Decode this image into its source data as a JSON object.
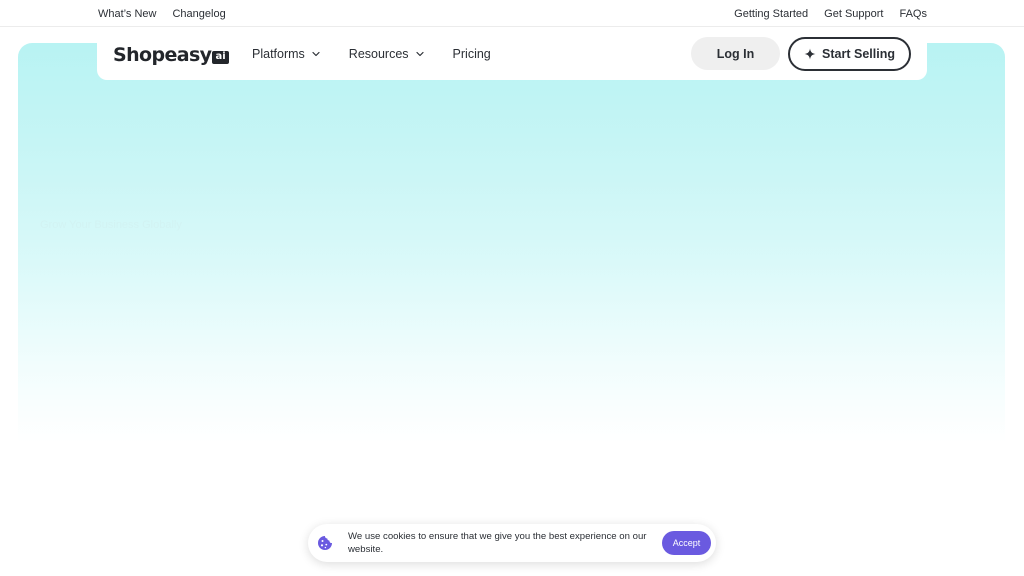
{
  "topbar": {
    "left_links": [
      {
        "label": "What’s New"
      },
      {
        "label": "Changelog"
      }
    ],
    "right_links": [
      {
        "label": "Getting Started"
      },
      {
        "label": "Get Support"
      },
      {
        "label": "FAQs"
      }
    ]
  },
  "navbar": {
    "logo_text": "Shopeasy",
    "logo_badge": "ai",
    "items": [
      {
        "label": "Platforms",
        "icon": "chevron-down-icon"
      },
      {
        "label": "Resources",
        "icon": "chevron-down-icon"
      },
      {
        "label": "Pricing"
      }
    ],
    "login_label": "Log In",
    "start_label": "Start Selling",
    "start_icon": "sparkle-icon"
  },
  "hero": {
    "faint_text": "Grow Your Business Globally"
  },
  "cookie": {
    "icon": "cookie-icon",
    "message": "We use cookies to ensure that we give you the best experience on our website.",
    "accept_label": "Accept",
    "accept_color": "#6a5ae0"
  },
  "colors": {
    "hero_top": "#b8f3f3",
    "text_dark": "#23262b",
    "accent": "#6a5ae0"
  }
}
